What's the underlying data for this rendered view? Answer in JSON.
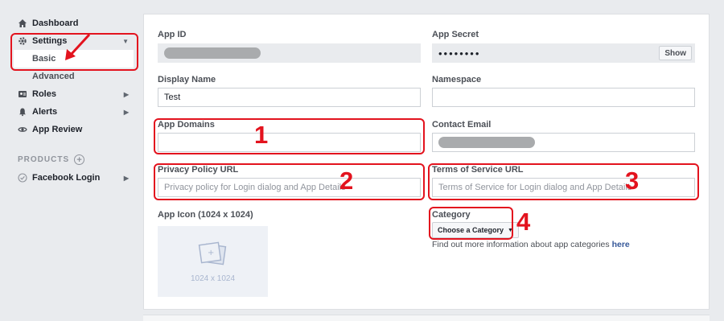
{
  "sidebar": {
    "dashboard": "Dashboard",
    "settings": "Settings",
    "basic": "Basic",
    "advanced": "Advanced",
    "roles": "Roles",
    "alerts": "Alerts",
    "app_review": "App Review",
    "products_heading": "PRODUCTS",
    "facebook_login": "Facebook Login"
  },
  "form": {
    "app_id_label": "App ID",
    "app_secret_label": "App Secret",
    "app_secret_value": "••••••••",
    "show_button": "Show",
    "display_name_label": "Display Name",
    "display_name_value": "Test",
    "namespace_label": "Namespace",
    "namespace_value": "",
    "app_domains_label": "App Domains",
    "app_domains_value": "",
    "contact_email_label": "Contact Email",
    "privacy_label": "Privacy Policy URL",
    "privacy_placeholder": "Privacy policy for Login dialog and App Details",
    "tos_label": "Terms of Service URL",
    "tos_placeholder": "Terms of Service for Login dialog and App Details",
    "app_icon_label": "App Icon (1024 x 1024)",
    "app_icon_size": "1024 x 1024",
    "category_label": "Category",
    "category_select": "Choose a Category",
    "category_hint": "Find out more information about app categories",
    "category_hint_link": "here"
  },
  "annotations": {
    "n1": "1",
    "n2": "2",
    "n3": "3",
    "n4": "4"
  },
  "colors": {
    "annotation": "#e3131e",
    "link": "#365899"
  }
}
